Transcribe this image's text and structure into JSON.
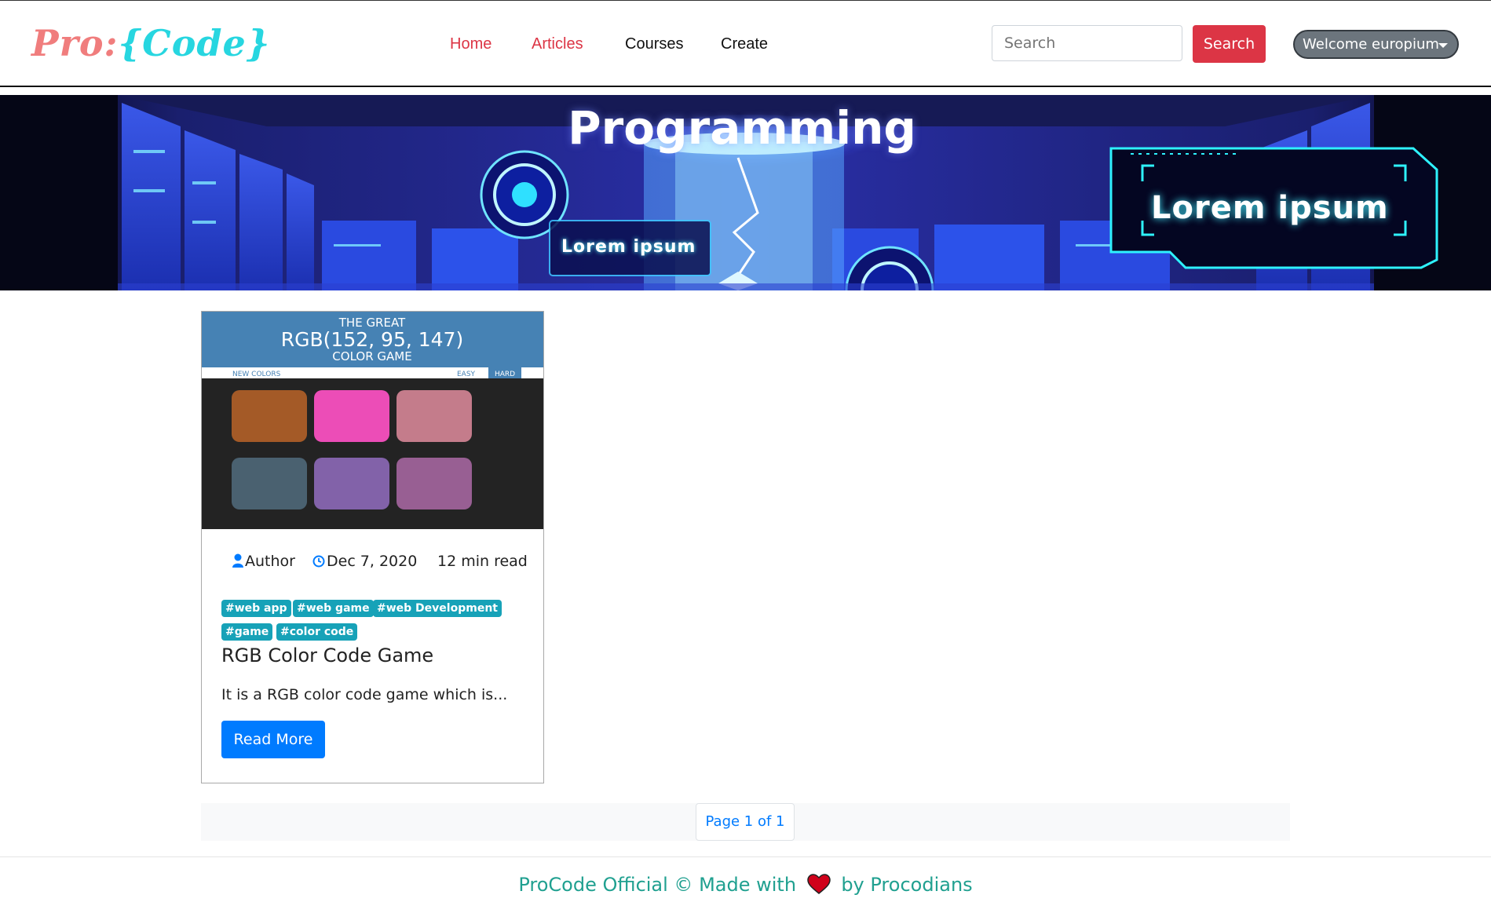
{
  "brand": {
    "part1": "Pro:",
    "part2": "{Code}"
  },
  "nav": {
    "home": "Home",
    "articles": "Articles",
    "courses": "Courses",
    "create": "Create"
  },
  "search": {
    "placeholder": "Search",
    "value": "",
    "button": "Search"
  },
  "user": {
    "label": "Welcome europium"
  },
  "banner": {
    "title": "Programming",
    "lorem_small": "Lorem ipsum",
    "lorem_big": "Lorem ipsum"
  },
  "article": {
    "thumbnail": {
      "heading_top": "THE GREAT",
      "heading_main": "RGB(152, 95, 147)",
      "heading_bottom": "COLOR GAME",
      "bar_left": "NEW COLORS",
      "bar_easy": "EASY",
      "bar_hard": "HARD",
      "swatches": [
        "#a45a27",
        "#ec4db7",
        "#c47c8b",
        "#4a6170",
        "#8262a9",
        "#985f93"
      ]
    },
    "author": "Author",
    "date": "Dec 7, 2020",
    "read_time": "12 min read",
    "tags": [
      "#web app",
      "#web game",
      "#web Development",
      "#game",
      "#color code"
    ],
    "title": "RGB Color Code Game",
    "excerpt": "It is a RGB color code game which is...",
    "read_more": "Read More"
  },
  "pagination": {
    "label": "Page 1 of 1"
  },
  "footer": {
    "left": "ProCode Official © Made with",
    "right": "by Procodians"
  },
  "colors": {
    "accent_red": "#dc3545",
    "primary_blue": "#007bff",
    "tag_teal": "#17a2b8",
    "footer_teal": "#20a090",
    "brand_pink": "#f07d7d",
    "brand_cyan": "#27d6e0"
  }
}
